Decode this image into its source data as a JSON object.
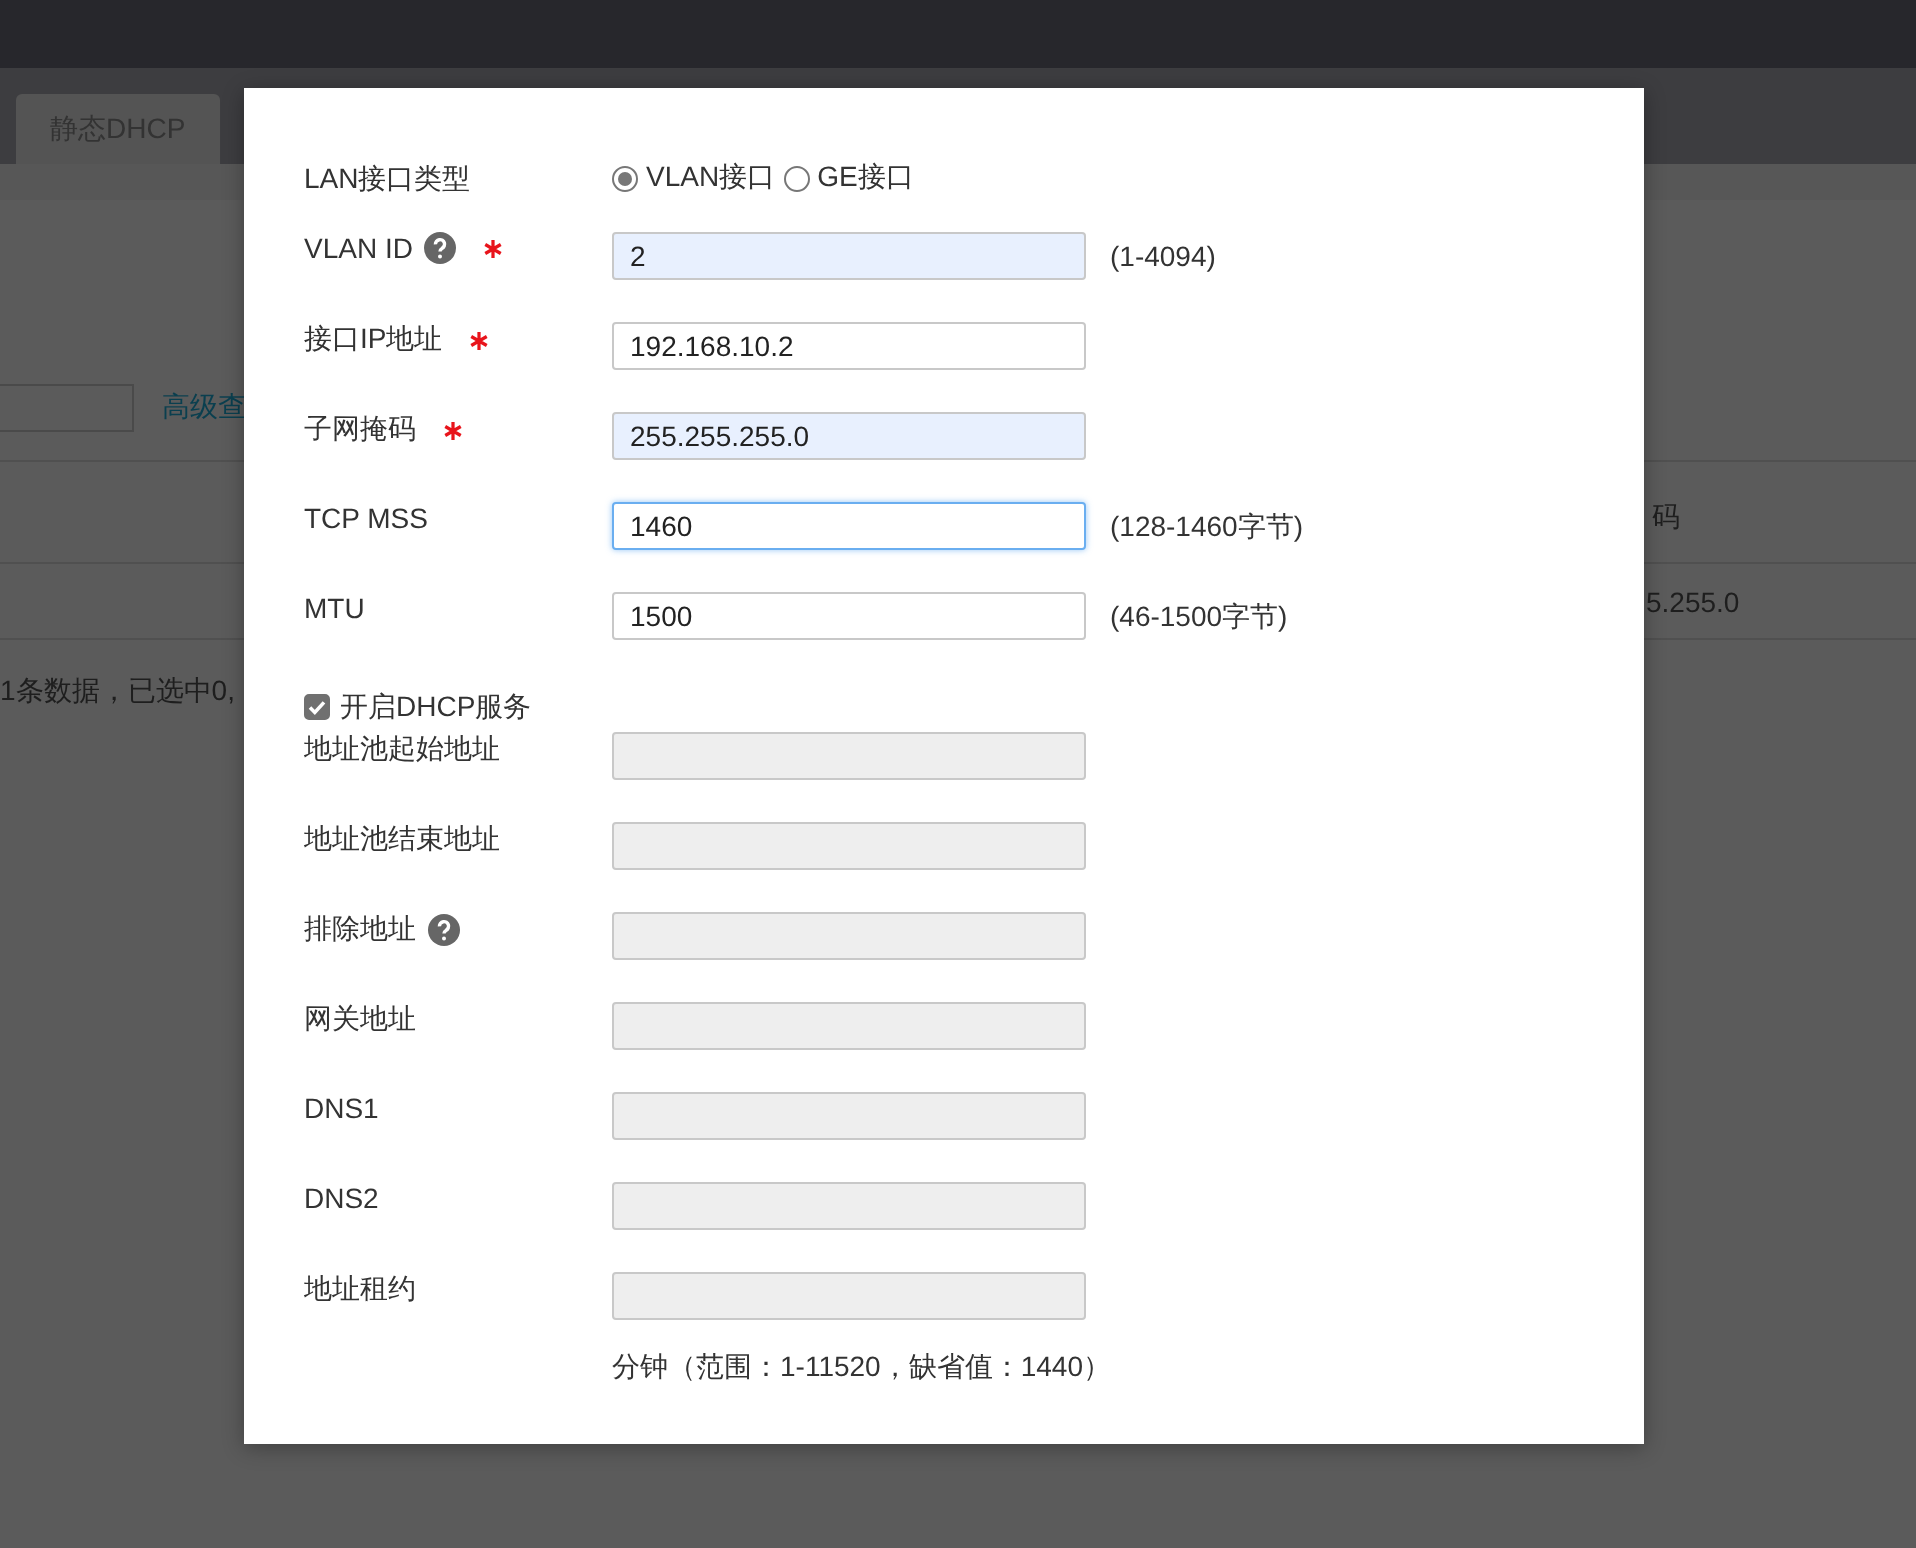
{
  "background": {
    "tabs": [
      {
        "label": "静态DHCP",
        "selected": false
      }
    ],
    "advanced_link": "高级查",
    "table": {
      "column_header": "码",
      "cell": "5.255.0"
    },
    "footer": "1条数据，已选中0,"
  },
  "dialog": {
    "interface_type": {
      "label": "LAN接口类型",
      "options": [
        {
          "label": "VLAN接口",
          "selected": true
        },
        {
          "label": "GE接口",
          "selected": false
        }
      ]
    },
    "fields": [
      {
        "label": "VLAN ID",
        "help": true,
        "required": true,
        "value": "2",
        "highlighted": true,
        "focused": false,
        "disabled": false,
        "hint": "(1-4094)"
      },
      {
        "label": "接口IP地址",
        "help": false,
        "required": true,
        "value": "192.168.10.2",
        "highlighted": false,
        "focused": false,
        "disabled": false
      },
      {
        "label": "子网掩码",
        "help": false,
        "required": true,
        "value": "255.255.255.0",
        "highlighted": true,
        "focused": false,
        "disabled": false
      },
      {
        "label": "TCP MSS",
        "help": false,
        "required": false,
        "value": "1460",
        "highlighted": false,
        "focused": true,
        "disabled": false,
        "hint": "(128-1460字节)"
      },
      {
        "label": "MTU",
        "help": false,
        "required": false,
        "value": "1500",
        "highlighted": false,
        "focused": false,
        "disabled": false,
        "hint": "(46-1500字节)"
      }
    ],
    "dhcp": {
      "label": "开启DHCP服务",
      "checked": true
    },
    "dhcp_fields": [
      {
        "label": "地址池起始地址",
        "help": false,
        "required": false,
        "highlighted": false,
        "focused": false,
        "disabled": true
      },
      {
        "label": "地址池结束地址",
        "help": false,
        "required": false,
        "highlighted": false,
        "focused": false,
        "disabled": true
      },
      {
        "label": "排除地址",
        "help": true,
        "required": false,
        "highlighted": false,
        "focused": false,
        "disabled": true
      },
      {
        "label": "网关地址",
        "help": false,
        "required": false,
        "highlighted": false,
        "focused": false,
        "disabled": true
      },
      {
        "label": "DNS1",
        "help": false,
        "required": false,
        "highlighted": false,
        "focused": false,
        "disabled": true
      },
      {
        "label": "DNS2",
        "help": false,
        "required": false,
        "highlighted": false,
        "focused": false,
        "disabled": true
      },
      {
        "label": "地址租约",
        "help": false,
        "required": false,
        "highlighted": false,
        "focused": false,
        "disabled": true
      }
    ],
    "footnote": "分钟（范围：1-11520，缺省值：1440）"
  }
}
